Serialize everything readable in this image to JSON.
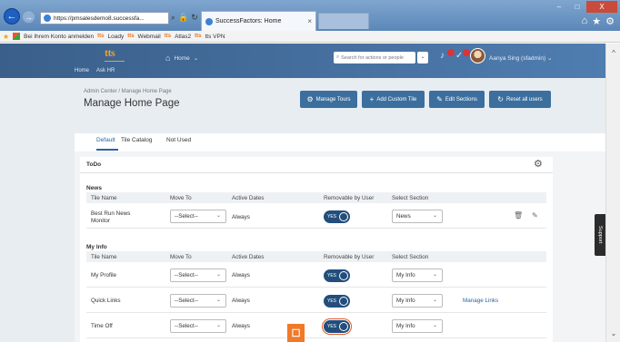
{
  "browser": {
    "url": "https://pmsalesdemo8.successfa...",
    "tab_title": "SuccessFactors: Home",
    "tab_close": "×",
    "addr_search_icon": "⌕",
    "addr_lock_icon": "🔒",
    "addr_refresh_icon": "↻",
    "favorites": [
      "Bei Ihrem Konto anmelden",
      "Loady",
      "Webmail",
      "Atlas2",
      "tts VPN"
    ],
    "favorites_prefix": "tts",
    "min": "–",
    "max": "□",
    "close": "X"
  },
  "header": {
    "logo": "tts",
    "home_label": "Home",
    "search_placeholder": "Search for actions or people",
    "user_name": "Aanya Sing (sfadmin)",
    "subnav": [
      "Home",
      "Ask HR"
    ]
  },
  "panel": {
    "breadcrumb": "Admin Center / Manage Home Page",
    "title": "Manage Home Page",
    "buttons": {
      "manage_tours": "Manage Tours",
      "add_custom_tile": "Add Custom Tile",
      "edit_sections": "Edit Sections",
      "reset_all_users": "Reset all users"
    }
  },
  "tabs": [
    "Default",
    "Tile Catalog",
    "Not Used"
  ],
  "card": {
    "title": "ToDo",
    "columns": [
      "Tile Name",
      "Move To",
      "Active Dates",
      "Removable by User",
      "Select Section"
    ],
    "sections": [
      {
        "title": "News",
        "rows": [
          {
            "name": "Best Run News Monitor",
            "move_to": "--Select--",
            "dates": "Always",
            "removable": "YES",
            "section": "News"
          }
        ]
      },
      {
        "title": "My Info",
        "rows": [
          {
            "name": "My Profile",
            "move_to": "--Select--",
            "dates": "Always",
            "removable": "YES",
            "section": "My Info"
          },
          {
            "name": "Quick Links",
            "move_to": "--Select--",
            "dates": "Always",
            "removable": "YES",
            "section": "My Info",
            "link": "Manage Links"
          },
          {
            "name": "Time Off",
            "move_to": "--Select--",
            "dates": "Always",
            "removable": "YES",
            "section": "My Info"
          }
        ]
      }
    ]
  },
  "support_label": "Support"
}
